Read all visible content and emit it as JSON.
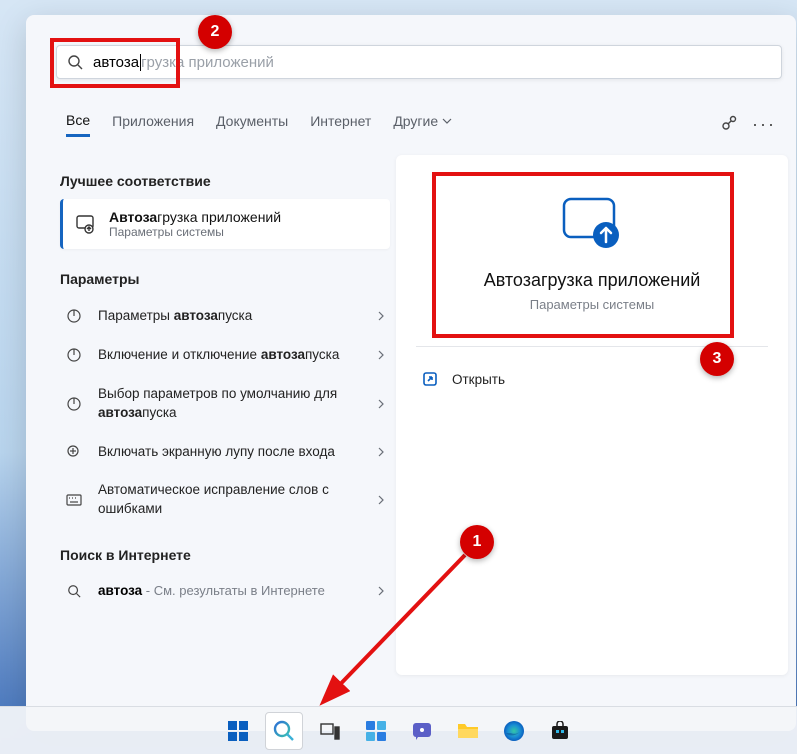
{
  "markers": {
    "m1": "1",
    "m2": "2",
    "m3": "3"
  },
  "search": {
    "typed": "автоза",
    "placeholder": "грузка приложений"
  },
  "tabs": {
    "all": "Все",
    "apps": "Приложения",
    "docs": "Документы",
    "web": "Интернет",
    "other": "Другие"
  },
  "sections": {
    "best": "Лучшее соответствие",
    "params": "Параметры",
    "websearch": "Поиск в Интернете"
  },
  "bestMatch": {
    "titlePrefix": "Автоза",
    "titleRest": "грузка приложений",
    "subtitle": "Параметры системы"
  },
  "settings": [
    {
      "pre": "Параметры ",
      "bold": "автоза",
      "post": "пуска"
    },
    {
      "pre": "Включение и отключение ",
      "bold": "автоза",
      "post": "пуска"
    },
    {
      "pre": "Выбор параметров по умолчанию для ",
      "bold": "автоза",
      "post": "пуска"
    },
    {
      "pre": "Включать экранную лупу после входа",
      "bold": "",
      "post": ""
    },
    {
      "pre": "Автоматическое исправление слов с ошибками",
      "bold": "",
      "post": ""
    }
  ],
  "webItem": {
    "term": "автоза",
    "hint": " - См. результаты в Интернете"
  },
  "detail": {
    "title": "Автозагрузка приложений",
    "subtitle": "Параметры системы",
    "open": "Открыть"
  }
}
